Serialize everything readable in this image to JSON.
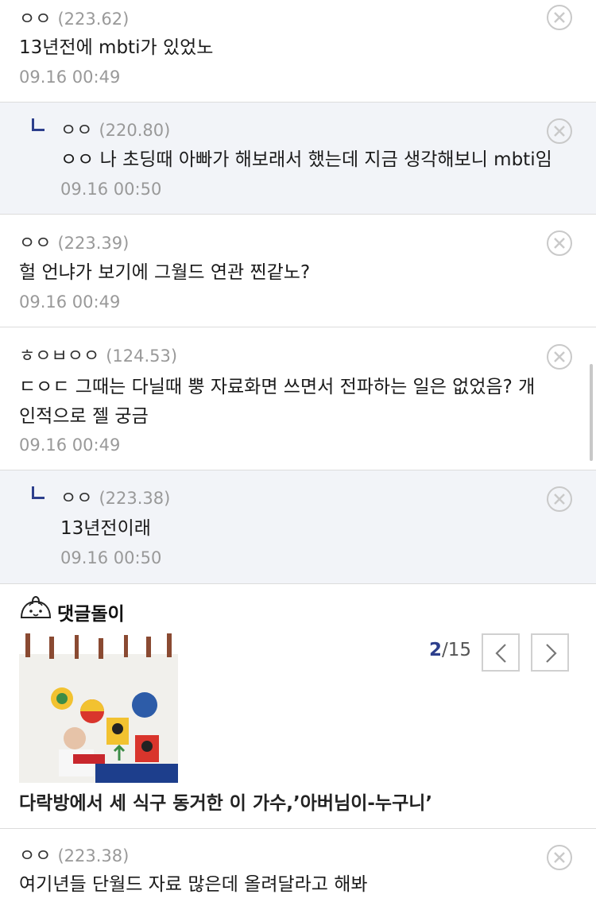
{
  "comments": [
    {
      "author": "ㅇㅇ",
      "ip": "(223.62)",
      "text": "13년전에 mbti가 있었노",
      "date": "09.16 00:49"
    },
    {
      "author": "ㅇㅇ",
      "ip": "(220.80)",
      "text": "ㅇㅇ 나 초딩때 아빠가 해보래서 했는데 지금 생각해보니 mbti임",
      "date": "09.16 00:50"
    },
    {
      "author": "ㅇㅇ",
      "ip": "(223.39)",
      "text": "헐 언냐가 보기에 그월드 연관 찐같노?",
      "date": "09.16 00:49"
    },
    {
      "author": "ㅎㅇㅂㅇㅇ",
      "ip": "(124.53)",
      "text_line1": "ㄷㅇㄷ 그때는 다닐때 뿡 자료화면 쓰면서 전파하는 일은 없었음? 개",
      "text_line2": "인적으로 젤 궁금",
      "date": "09.16 00:49"
    },
    {
      "author": "ㅇㅇ",
      "ip": "(223.38)",
      "text": "13년전이래",
      "date": "09.16 00:50"
    },
    {
      "author": "ㅇㅇ",
      "ip": "(223.38)",
      "text": "여기년들 단월드 자료 많은데 올려달라고 해봐"
    }
  ],
  "dolgi": {
    "title": "댓글돌이",
    "page_current": "2",
    "page_total": "/15",
    "headline": "다락방에서 세 식구 동거한 이 가수,’아버님이-누구니’"
  },
  "icons": {
    "delete": "close-circle-icon",
    "reply": "reply-arrow-icon",
    "prev": "chevron-left-icon",
    "next": "chevron-right-icon",
    "dolgi": "dumpling-mascot-icon"
  },
  "colors": {
    "accent": "#2d3f8c",
    "reply_bg": "#f2f4f8",
    "meta_gray": "#999999"
  }
}
